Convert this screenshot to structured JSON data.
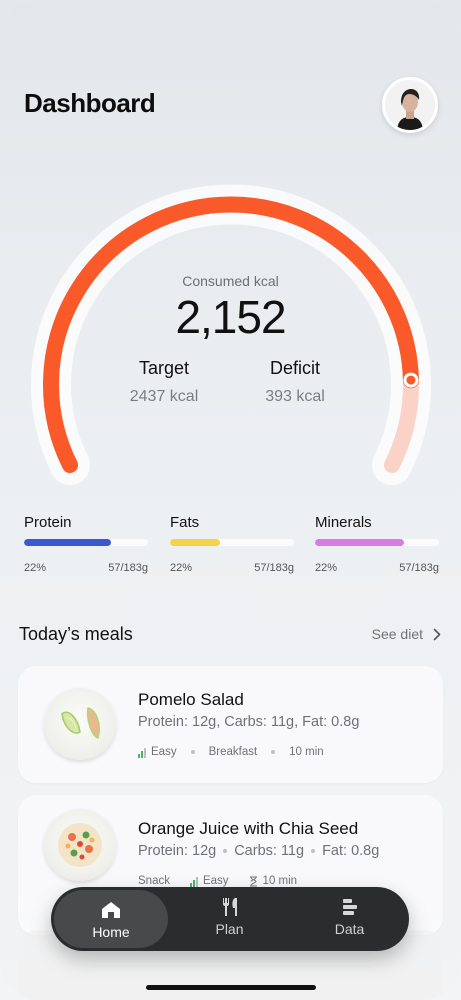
{
  "header": {
    "title": "Dashboard"
  },
  "calories": {
    "consumed_label": "Consumed kcal",
    "consumed_value": "2,152",
    "progress": 0.88,
    "target_label": "Target",
    "target_value": "2437 kcal",
    "deficit_label": "Deficit",
    "deficit_value": "393 kcal"
  },
  "macros": [
    {
      "name": "Protein",
      "percent": "22%",
      "amount": "57/183g",
      "fill": 0.7,
      "color": "#3a59d1"
    },
    {
      "name": "Fats",
      "percent": "22%",
      "amount": "57/183g",
      "fill": 0.4,
      "color": "#f3d34a"
    },
    {
      "name": "Minerals",
      "percent": "22%",
      "amount": "57/183g",
      "fill": 0.72,
      "color": "#d77be3"
    }
  ],
  "meals_section": {
    "title": "Today’s meals",
    "see_link": "See diet"
  },
  "meals": [
    {
      "name": "Pomelo Salad",
      "macros": "Protein: 12g, Carbs: 11g, Fat: 0.8g",
      "difficulty": "Easy",
      "type": "Breakfast",
      "time": "10 min"
    },
    {
      "name": "Orange Juice with Chia Seed",
      "macros_protein": "Protein: 12g",
      "macros_carbs": "Carbs: 11g",
      "macros_fat": "Fat: 0.8g",
      "type": "Snack",
      "difficulty": "Easy",
      "time": "10 min"
    }
  ],
  "nav": {
    "home": "Home",
    "plan": "Plan",
    "data": "Data"
  },
  "colors": {
    "accent": "#fa5a2a",
    "accent_light": "#fbd2c6"
  },
  "icons": [
    "home-icon",
    "fork-knife-icon",
    "bar-chart-icon",
    "chevron-right-icon",
    "hourglass-icon",
    "signal-icon"
  ]
}
